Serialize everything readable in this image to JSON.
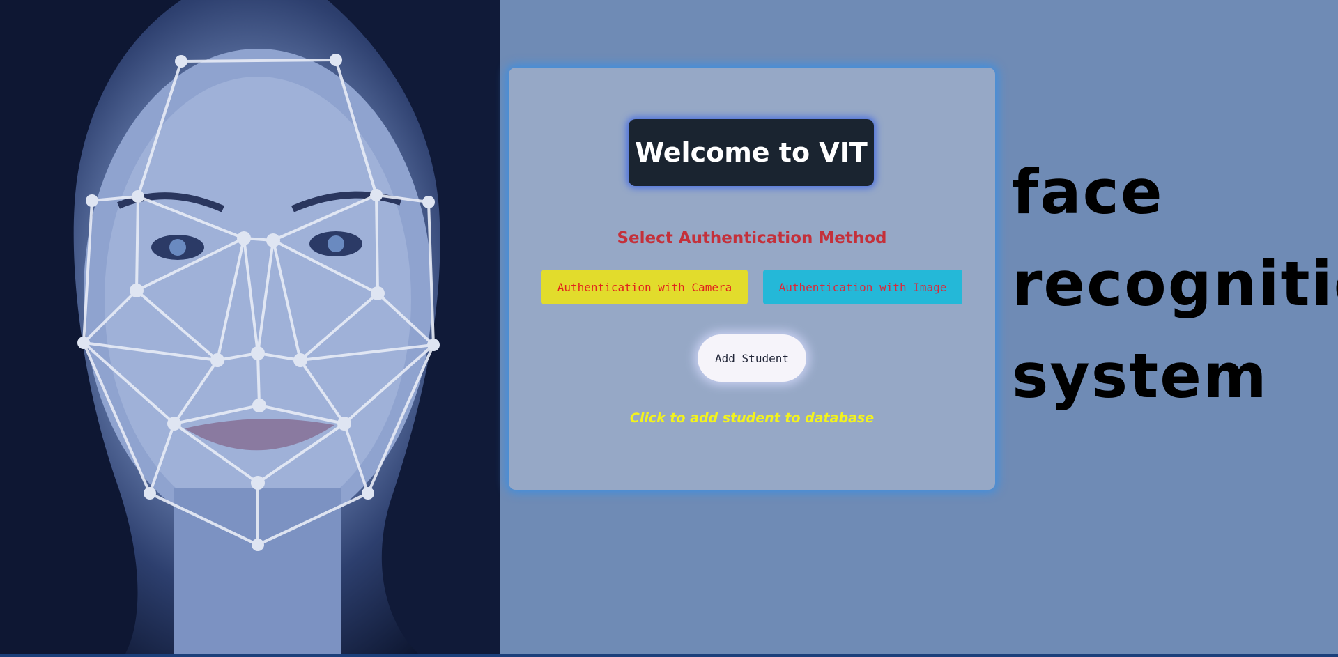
{
  "card": {
    "welcome": "Welcome to VIT",
    "select_heading": "Select Authentication Method",
    "camera_button": "Authentication with Camera",
    "image_button": "Authentication with Image",
    "add_student_button": "Add Student",
    "hint": "Click to add student to database"
  },
  "side_title": {
    "line1": "face",
    "line2": "recognition",
    "line3": "system"
  },
  "colors": {
    "background": "#6f8bb5",
    "card": "#96a8c6",
    "card_glow": "#3f8fe0",
    "welcome_bg": "#1a2430",
    "heading": "#c4303a",
    "camera_btn": "#e2dc2c",
    "image_btn": "#24b8d8",
    "hint": "#f2f21e"
  },
  "hero_image": {
    "icon": "face-mesh-portrait"
  }
}
